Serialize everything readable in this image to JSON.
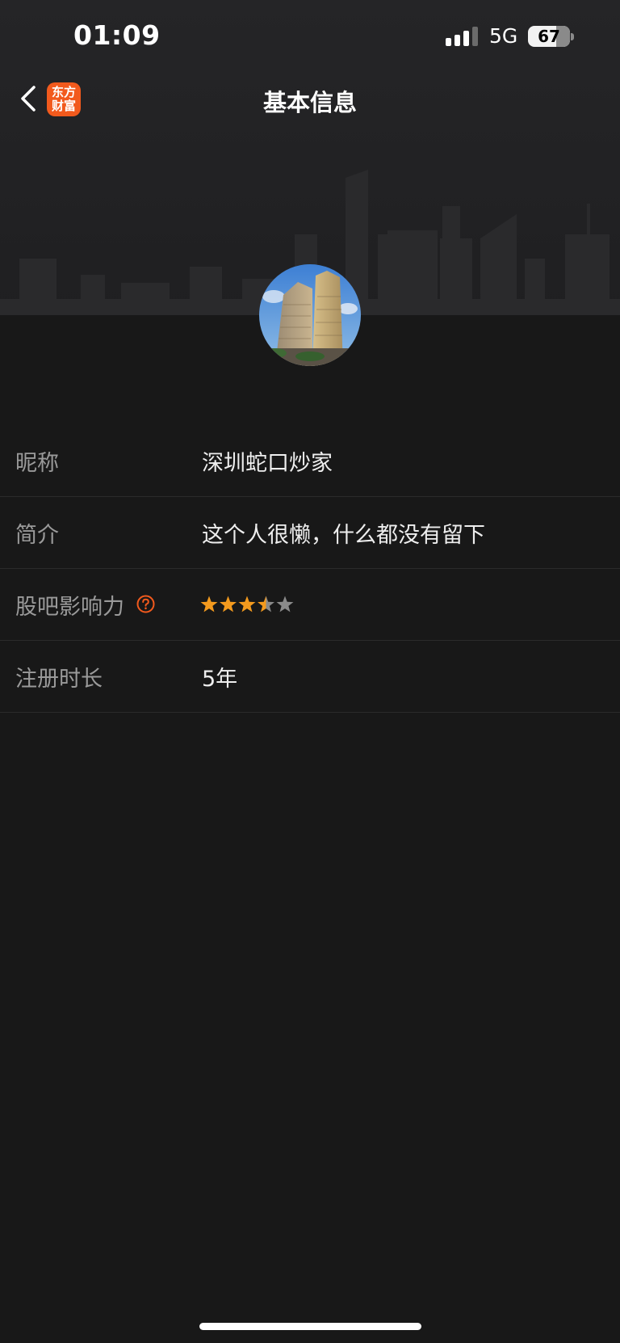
{
  "status_bar": {
    "time": "01:09",
    "network": "5G",
    "battery": "67",
    "signal_bars_active": 3
  },
  "nav": {
    "title": "基本信息",
    "logo_line1": "东方",
    "logo_line2": "财富",
    "logo_color": "#f25a1d"
  },
  "profile": {
    "rows": [
      {
        "label": "昵称",
        "value": "深圳蛇口炒家"
      },
      {
        "label": "简介",
        "value": "这个人很懒，什么都没有留下"
      },
      {
        "label": "股吧影响力",
        "rating": 3.5,
        "rating_max": 5,
        "star_color": "#f39a1e"
      },
      {
        "label": "注册时长",
        "value": "5年"
      }
    ]
  },
  "colors": {
    "background": "#181818",
    "accent": "#f25a1d",
    "label": "#9a9a9a",
    "value": "#eeeeee"
  }
}
